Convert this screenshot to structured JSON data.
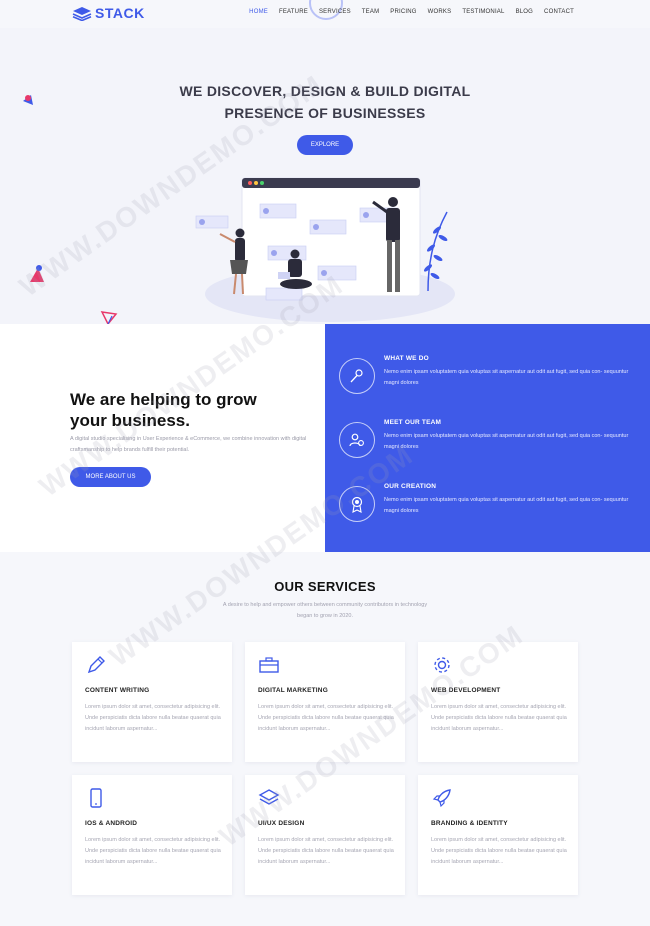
{
  "nav": {
    "logo_text": "STACK",
    "items": [
      "HOME",
      "FEATURE",
      "SERVICES",
      "TEAM",
      "PRICING",
      "WORKS",
      "TESTIMONIAL",
      "BLOG",
      "CONTACT"
    ]
  },
  "hero": {
    "title_line1": "WE DISCOVER, DESIGN & BUILD DIGITAL",
    "title_line2": "PRESENCE OF BUSINESSES",
    "button": "EXPLORE"
  },
  "about": {
    "title_line1": "We are helping to grow",
    "title_line2": "your business.",
    "description": "A digital studio specialising in User Experience & eCommerce, we combine innovation with digital craftsmanship to help brands fulfill their potential.",
    "button": "MORE ABOUT US"
  },
  "features": [
    {
      "title": "WHAT WE DO",
      "icon": "pen-nib-icon",
      "description": "Nemo enim ipsam voluptatem quia voluptas sit aspernatur aut odit aut fugit, sed quia con- sequuntur magni dolores"
    },
    {
      "title": "MEET OUR TEAM",
      "icon": "team-users-icon",
      "description": "Nemo enim ipsam voluptatem quia voluptas sit aspernatur aut odit aut fugit, sed quia con- sequuntur magni dolores"
    },
    {
      "title": "OUR CREATION",
      "icon": "award-badge-icon",
      "description": "Nemo enim ipsam voluptatem quia voluptas sit aspernatur aut odit aut fugit, sed quia con- sequuntur magni dolores"
    }
  ],
  "services": {
    "title": "OUR SERVICES",
    "subtitle_line1": "A desire to help and empower others between community contributors in technology",
    "subtitle_line2": "began to grow in 2020.",
    "cards": [
      {
        "title": "CONTENT WRITING",
        "icon": "pencil-icon",
        "description": "Lorem ipsum dolor sit amet, consectetur adipisicing elit. Unde perspiciatis dicta labore nulla beatae quaerat quia incidunt laborum aspernatur..."
      },
      {
        "title": "DIGITAL MARKETING",
        "icon": "briefcase-icon",
        "description": "Lorem ipsum dolor sit amet, consectetur adipisicing elit. Unde perspiciatis dicta labore nulla beatae quaerat quia incidunt laborum aspernatur..."
      },
      {
        "title": "WEB DEVELOPMENT",
        "icon": "gear-icon",
        "description": "Lorem ipsum dolor sit amet, consectetur adipisicing elit. Unde perspiciatis dicta labore nulla beatae quaerat quia incidunt laborum aspernatur..."
      },
      {
        "title": "IOS & ANDROID",
        "icon": "mobile-icon",
        "description": "Lorem ipsum dolor sit amet, consectetur adipisicing elit. Unde perspiciatis dicta labore nulla beatae quaerat quia incidunt laborum aspernatur..."
      },
      {
        "title": "UI/UX DESIGN",
        "icon": "layers-icon",
        "description": "Lorem ipsum dolor sit amet, consectetur adipisicing elit. Unde perspiciatis dicta labore nulla beatae quaerat quia incidunt laborum aspernatur..."
      },
      {
        "title": "BRANDING & IDENTITY",
        "icon": "rocket-icon",
        "description": "Lorem ipsum dolor sit amet, consectetur adipisicing elit. Unde perspiciatis dicta labore nulla beatae quaerat quia incidunt laborum aspernatur..."
      }
    ]
  },
  "watermark": "WWW.DOWNDEMO.COM",
  "colors": {
    "accent": "#3f5ae8",
    "hero_bg": "#f3f4fa",
    "text_dark": "#111111"
  }
}
